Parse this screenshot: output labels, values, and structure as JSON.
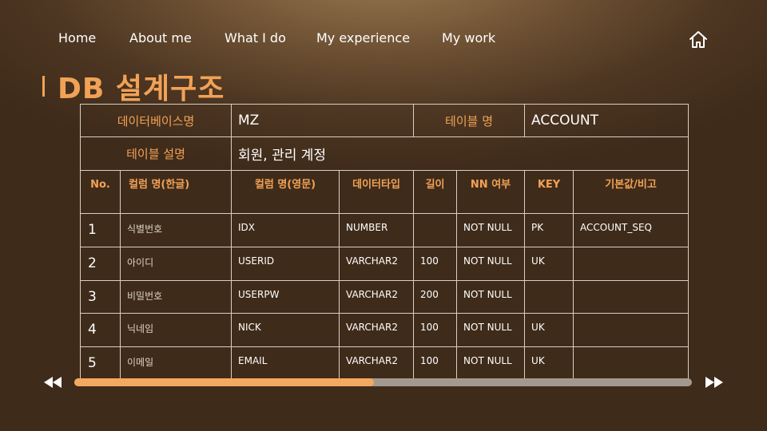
{
  "nav": {
    "items": [
      "Home",
      "About me",
      "What I do",
      "My experience",
      "My work"
    ]
  },
  "icons": {
    "home": "home-icon",
    "prev": "rewind-icon",
    "next": "fast-forward-icon"
  },
  "colors": {
    "accent": "#f1a256",
    "background": "#4d3622",
    "border": "#d8cfc4",
    "progress_fill": "#f4a960",
    "progress_track": "#a39a8f"
  },
  "page": {
    "title": "DB 설계구조"
  },
  "table": {
    "db_name_label": "데이터베이스명",
    "db_name": "MZ",
    "table_name_label": "테이블 명",
    "table_name": "ACCOUNT",
    "table_desc_label": "테이블 설명",
    "table_desc": "회원, 관리 계정",
    "headers": [
      "No.",
      "컬럼 명(한글)",
      "컬럼 명(영문)",
      "데이터타입",
      "길이",
      "NN 여부",
      "KEY",
      "기본값/비고"
    ],
    "rows": [
      [
        "1",
        "식별번호",
        "IDX",
        "NUMBER",
        "",
        "NOT NULL",
        "PK",
        "ACCOUNT_SEQ"
      ],
      [
        "2",
        "아이디",
        "USERID",
        "VARCHAR2",
        "100",
        "NOT NULL",
        "UK",
        ""
      ],
      [
        "3",
        "비밀번호",
        "USERPW",
        "VARCHAR2",
        "200",
        "NOT NULL",
        "",
        ""
      ],
      [
        "4",
        "닉네임",
        "NICK",
        "VARCHAR2",
        "100",
        "NOT NULL",
        "UK",
        ""
      ],
      [
        "5",
        "이메일",
        "EMAIL",
        "VARCHAR2",
        "100",
        "NOT NULL",
        "UK",
        ""
      ]
    ]
  },
  "progress": {
    "fraction": 0.485
  }
}
